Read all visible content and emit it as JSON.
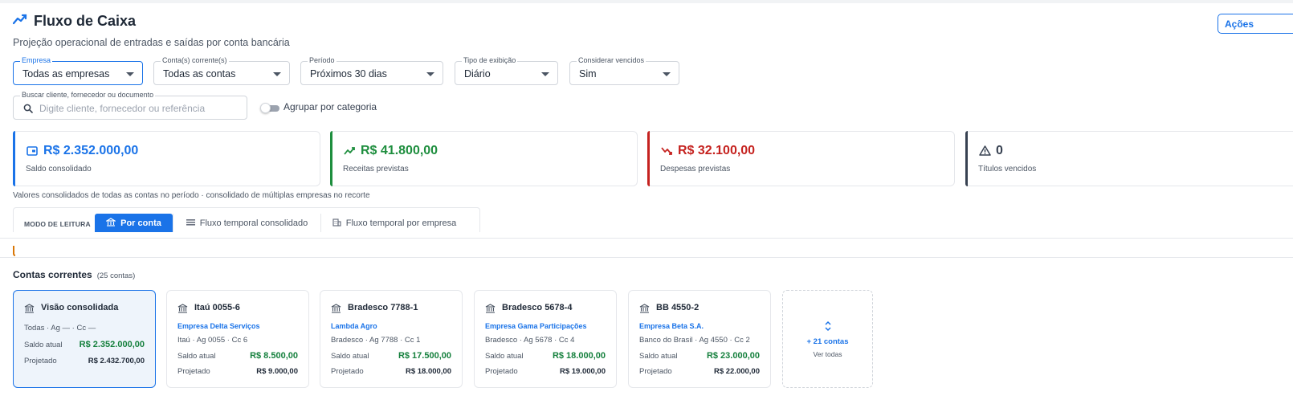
{
  "header": {
    "title": "Fluxo de Caixa",
    "subtitle": "Projeção operacional de entradas e saídas por conta bancária",
    "actions_label": "Ações"
  },
  "filters": {
    "empresa": {
      "label": "Empresa",
      "value": "Todas as empresas"
    },
    "contas": {
      "label": "Conta(s) corrente(s)",
      "value": "Todas as contas"
    },
    "periodo": {
      "label": "Período",
      "value": "Próximos 30 dias"
    },
    "tipo": {
      "label": "Tipo de exibição",
      "value": "Diário"
    },
    "vencidos": {
      "label": "Considerar vencidos",
      "value": "Sim"
    },
    "search": {
      "label": "Buscar cliente, fornecedor ou documento",
      "placeholder": "Digite cliente, fornecedor ou referência",
      "value": ""
    },
    "agrupar": {
      "label": "Agrupar por categoria",
      "on": false
    }
  },
  "kpis": [
    {
      "value": "R$ 2.352.000,00",
      "label": "Saldo consolidado",
      "color": "#1a73e8",
      "icon": "wallet-icon"
    },
    {
      "value": "R$ 41.800,00",
      "label": "Receitas previstas",
      "color": "#1e8e3e",
      "icon": "trending-up-icon"
    },
    {
      "value": "R$ 32.100,00",
      "label": "Despesas previstas",
      "color": "#c5221f",
      "icon": "trending-down-icon"
    },
    {
      "value": "0",
      "label": "Títulos vencidos",
      "color": "#374151",
      "icon": "warning-icon"
    }
  ],
  "note": "Valores consolidados de todas as contas no período · consolidado de múltiplas empresas no recorte",
  "modes": {
    "label": "MODO DE LEITURA",
    "tabs": [
      {
        "label": "Por conta",
        "active": true,
        "icon": "bank-icon"
      },
      {
        "label": "Fluxo temporal consolidado",
        "active": false,
        "icon": "list-icon"
      },
      {
        "label": "Fluxo temporal por empresa",
        "active": false,
        "icon": "building-icon"
      }
    ]
  },
  "accounts": {
    "title": "Contas correntes",
    "count": "(25 contas)",
    "consolidated": {
      "name": "Visão consolidada",
      "details": "Todas · Ag — · Cc —",
      "saldo_label": "Saldo atual",
      "saldo": "R$ 2.352.000,00",
      "proj_label": "Projetado",
      "proj": "R$ 2.432.700,00"
    },
    "items": [
      {
        "name": "Itaú 0055-6",
        "empresa": "Empresa Delta Serviços",
        "details": "Itaú · Ag 0055 · Cc 6",
        "saldo_label": "Saldo atual",
        "saldo": "R$ 8.500,00",
        "proj_label": "Projetado",
        "proj": "R$ 9.000,00"
      },
      {
        "name": "Bradesco 7788-1",
        "empresa": "Lambda Agro",
        "details": "Bradesco · Ag 7788 · Cc 1",
        "saldo_label": "Saldo atual",
        "saldo": "R$ 17.500,00",
        "proj_label": "Projetado",
        "proj": "R$ 18.000,00"
      },
      {
        "name": "Bradesco 5678-4",
        "empresa": "Empresa Gama Participações",
        "details": "Bradesco · Ag 5678 · Cc 4",
        "saldo_label": "Saldo atual",
        "saldo": "R$ 18.000,00",
        "proj_label": "Projetado",
        "proj": "R$ 19.000,00"
      },
      {
        "name": "BB 4550-2",
        "empresa": "Empresa Beta S.A.",
        "details": "Banco do Brasil · Ag 4550 · Cc 2",
        "saldo_label": "Saldo atual",
        "saldo": "R$ 23.000,00",
        "proj_label": "Projetado",
        "proj": "R$ 22.000,00"
      }
    ],
    "more": {
      "count": "+ 21 contas",
      "label": "Ver todas"
    }
  },
  "colors": {
    "accent": "#1a73e8",
    "positive": "#15803d",
    "negative": "#c5221f",
    "warning": "#d97706"
  }
}
